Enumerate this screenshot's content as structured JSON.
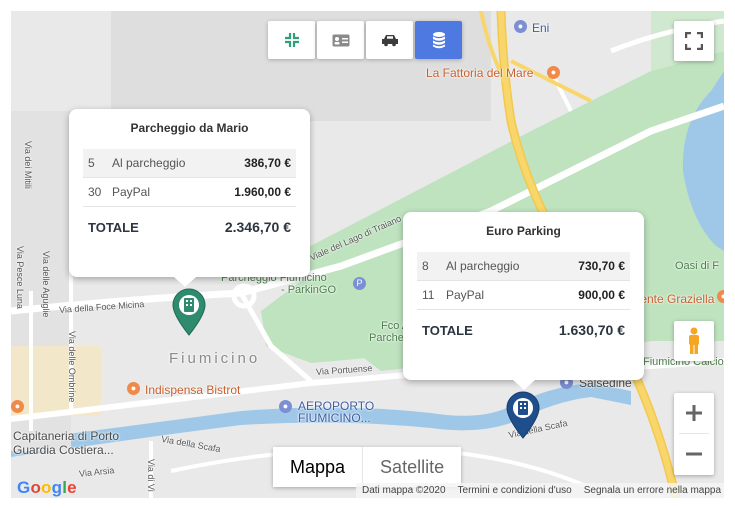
{
  "toolbar": {
    "buttons": [
      {
        "icon": "compress-icon",
        "active": false
      },
      {
        "icon": "id-card-icon",
        "active": false
      },
      {
        "icon": "car-icon",
        "active": false
      },
      {
        "icon": "coins-icon",
        "active": true
      }
    ]
  },
  "map": {
    "labels": {
      "eni": "Eni",
      "fattoria": "La Fattoria del Mare",
      "parcheggio_fiumicino": "Parcheggio Fiumicino",
      "parkingo": "- ParkinGO",
      "fco_airport": "Fco Airp",
      "parcheggio_fco": "Parcheggio",
      "fiumicino": "Fiumicino",
      "via_portuense": "Via Portuense",
      "indispensa": "Indispensa Bistrot",
      "aeroporto_1": "AEROPORTO",
      "aeroporto_2": "FIUMICINO...",
      "capitaneria_1": "Capitaneria di Porto",
      "capitaneria_2": "Guardia Costiera...",
      "via_della_scafa_1": "Via della Scafa",
      "via_della_scafa_2": "Via della Scafa",
      "via_foce_micina": "Via della Foce Micina",
      "viale_lago_traiano": "Viale del Lago di Traiano",
      "salsedine": "Salsedine",
      "oasi": "Oasi di F",
      "gente_graziella": "Gente Graziella",
      "fiumicino_calcio": "Fiumicino Calcio",
      "via_dei_mitili": "Via dei Mitili",
      "via_delle_ombrine": "Via delle Ombrine",
      "via_pesce_luna": "Via Pesce Luna",
      "via_delle_aguglie": "Via delle Aguglie",
      "via_arsia": "Via Arsia",
      "via_di_vi": "Via di Vi"
    }
  },
  "parkings": [
    {
      "name": "Parcheggio da Mario",
      "rows": [
        {
          "count": "5",
          "method": "Al parcheggio",
          "amount": "386,70 €"
        },
        {
          "count": "30",
          "method": "PayPal",
          "amount": "1.960,00 €"
        }
      ],
      "total_label": "TOTALE",
      "total": "2.346,70 €",
      "marker_color": "#2e8b6d"
    },
    {
      "name": "Euro Parking",
      "rows": [
        {
          "count": "8",
          "method": "Al parcheggio",
          "amount": "730,70 €"
        },
        {
          "count": "11",
          "method": "PayPal",
          "amount": "900,00 €"
        }
      ],
      "total_label": "TOTALE",
      "total": "1.630,70 €",
      "marker_color": "#1f4e8c"
    }
  ],
  "map_type": {
    "map": "Mappa",
    "satellite": "Satellite"
  },
  "footer": {
    "logo": "Google",
    "map_data": "Dati mappa ©2020",
    "terms": "Termini e condizioni d'uso",
    "report": "Segnala un errore nella mappa"
  },
  "colors": {
    "accent": "#4e79e0",
    "park_green": "#bfe3bf",
    "water": "#9fc8e8",
    "road_yellow": "#f8d66b"
  }
}
